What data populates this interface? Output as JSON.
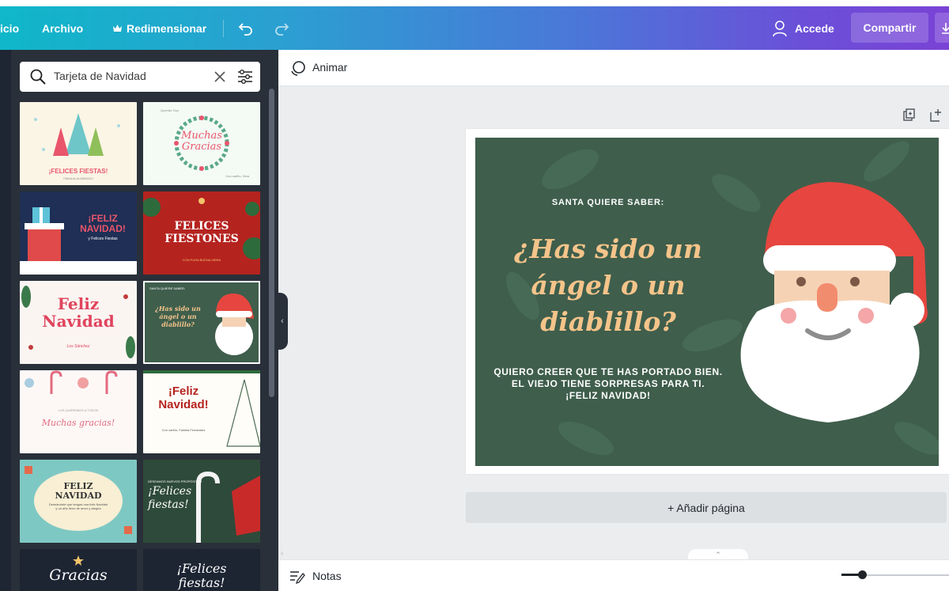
{
  "topbar": {
    "home_partial": "icio",
    "file": "Archivo",
    "resize": "Redimensionar",
    "undo_icon": "undo-icon",
    "redo_icon": "redo-icon",
    "signin": "Accede",
    "share": "Compartir",
    "download_icon": "download-icon"
  },
  "search": {
    "value": "Tarjeta de Navidad",
    "icons": [
      "search-icon",
      "clear-icon",
      "filter-icon"
    ]
  },
  "templates": [
    {
      "lines": [
        "¡FELICES FIESTAS!"
      ],
      "sub": "FAMILIA ALVARADO"
    },
    {
      "lines": [
        "Muchas",
        "Gracias"
      ],
      "top": "Querido Tiuo",
      "bottom": "Con cariño, Dina"
    },
    {
      "lines": [
        "¡FELIZ",
        "NAVIDAD!"
      ],
      "sub": "y Felices Fiestas"
    },
    {
      "lines": [
        "FELICES",
        "FIESTONES"
      ],
      "sub": "CON PURA BUENA VIBRA"
    },
    {
      "lines": [
        "Feliz",
        "Navidad"
      ],
      "sub": "Los Sánchez"
    },
    {
      "lines": [
        "¿Has sido un",
        "ángel o un",
        "diablillo?"
      ],
      "top": "SANTA QUIERE SABER:"
    },
    {
      "lines": [
        "Muchas gracias!"
      ],
      "top": "LOS QUEREMOS A TODOS"
    },
    {
      "lines": [
        "¡Feliz",
        "Navidad!"
      ],
      "sub": "Con cariño, Familia Fernández"
    },
    {
      "lines": [
        "FELIZ",
        "NAVIDAD"
      ],
      "sub": "Deseándote que tengas una feliz Navidad y un año lleno de amor y alegría"
    },
    {
      "lines": [
        "¡Felices",
        "fiestas!"
      ],
      "top": "DESEAMOS NUEVOS PROPÓSITOS"
    },
    {
      "lines": [
        "Gracias"
      ]
    },
    {
      "lines": [
        "¡Felices",
        "fiestas!"
      ]
    }
  ],
  "toolbar2": {
    "animate": "Animar",
    "animate_icon": "animate-icon"
  },
  "card": {
    "subtitle": "SANTA QUIERE SABER:",
    "title_lines": [
      "¿Has sido un",
      "ángel o un",
      "diablillo?"
    ],
    "body_lines": [
      "QUIERO CREER QUE TE HAS PORTADO BIEN.",
      "EL VIEJO TIENE SORPRESAS PARA TI.",
      "¡FELIZ NAVIDAD!"
    ],
    "bg_color": "#3f5e4c",
    "title_color": "#f4c48a"
  },
  "page_actions": {
    "duplicate_icon": "duplicate-page-icon",
    "add_icon": "add-page-icon"
  },
  "add_page": "+ Añadir página",
  "bottombar": {
    "notes": "Notas",
    "notes_icon": "notes-icon"
  },
  "zoom": {
    "level_fraction": 0.19
  }
}
